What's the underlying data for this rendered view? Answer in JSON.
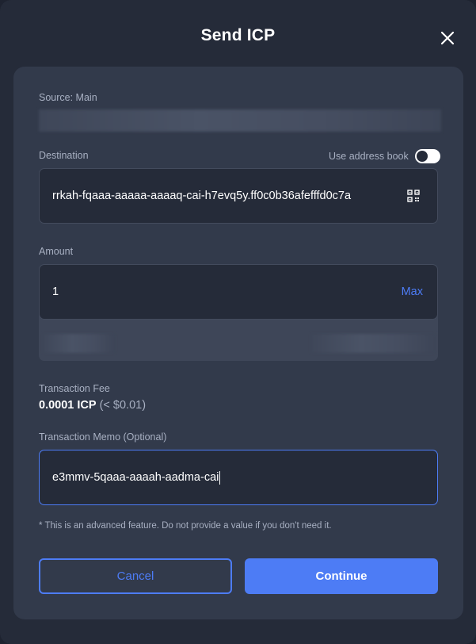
{
  "modal": {
    "title": "Send ICP"
  },
  "source": {
    "label": "Source: Main"
  },
  "destination": {
    "label": "Destination",
    "address_book_label": "Use address book",
    "value": "rrkah-fqaaa-aaaaa-aaaaq-cai-h7evq5y.ff0c0b36afefffd0c7a"
  },
  "amount": {
    "label": "Amount",
    "value": "1",
    "max_label": "Max"
  },
  "fee": {
    "label": "Transaction Fee",
    "value": "0.0001 ICP",
    "usd": "(< $0.01)"
  },
  "memo": {
    "label": "Transaction Memo (Optional)",
    "value": "e3mmv-5qaaa-aaaah-aadma-cai"
  },
  "note": "* This is an advanced feature. Do not provide a value if you don't need it.",
  "buttons": {
    "cancel": "Cancel",
    "continue": "Continue"
  },
  "colors": {
    "accent": "#4d7cf5",
    "panel": "#323a4b",
    "background": "#252b39"
  }
}
